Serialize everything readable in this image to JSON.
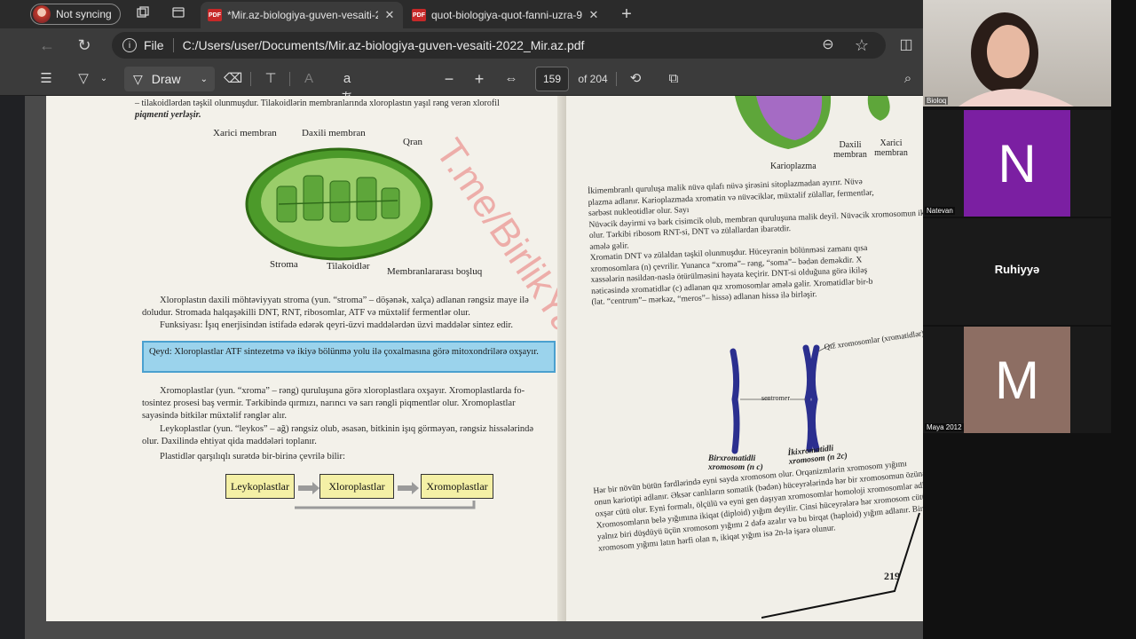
{
  "browser": {
    "profile": "Not syncing",
    "tabs": [
      {
        "title": "*Mir.az-biologiya-guven-vesaiti-2",
        "active": true
      },
      {
        "title": "quot-biologiya-quot-fanni-uzra-9",
        "active": false
      }
    ],
    "new_tab": "+",
    "address": {
      "scheme": "File",
      "path": "C:/Users/user/Documents/Mir.az-biologiya-guven-vesaiti-2022_Mir.az.pdf"
    }
  },
  "pdf_toolbar": {
    "draw_label": "Draw",
    "read_aloud": "aあ",
    "zoom_out": "−",
    "zoom_in": "+",
    "page_current": "159",
    "page_total": "of 204"
  },
  "left_page": {
    "top_line1": "– tilakoidlərdən təşkil olunmuşdur. Tilakoidlərin membranlarında xloroplastın yaşıl rəng verən xlorofil",
    "top_line2": "piqmenti yerləşir.",
    "labels": {
      "outer": "Xarici membran",
      "inner": "Daxili membran",
      "granum": "Qran",
      "stroma": "Stroma",
      "thylakoid": "Tilakoidlər",
      "intermembrane": "Membranlararası boşluq"
    },
    "para1_l1": "Xloroplastın daxili möhtəviyyatı stroma (yun. “stroma” – döşənək, xalça) adlanan rəngsiz maye ilə",
    "para1_l2": "doludur. Stromada halqaşəkilli DNT, RNT, ribosomlar, ATF və müxtəlif fermentlər olur.",
    "para1_l3": "Funksiyası: İşıq enerjisindən istifadə edərək qeyri-üzvi maddələrdən üzvi maddələr sintez edir.",
    "note": "Qeyd: Xloroplastlar ATF sintezetmə və ikiyə bölünmə yolu ilə çoxalmasına görə mitoxondrilərə oxşayır.",
    "para2_l1": "Xromoplastlar (yun. “xroma” – rəng) quruluşuna görə xloroplastlara oxşayır. Xromoplastlarda fo-",
    "para2_l2": "tosintez prosesi baş vermir. Tərkibində qırmızı, narıncı və sarı rəngli piqmentlər olur. Xromoplastlar",
    "para2_l3": "sayəsində bitkilər müxtəlif rənglər alır.",
    "para3_l1": "Leykoplastlar (yun. “leykos” – ağ) rəngsiz olub, əsasən, bitkinin işıq görməyən, rəngsiz hissələrində",
    "para3_l2": "olur. Daxilində ehtiyat qida maddələri toplanır.",
    "para4": "Plastidlər qarşılıqlı surətdə bir-birinə çevrilə bilir:",
    "flow": [
      "Leykoplastlar",
      "Xloroplastlar",
      "Xromoplastlar"
    ]
  },
  "right_page": {
    "labels": {
      "karyoplasm": "Karioplazma",
      "inner": "Daxili membran",
      "outer": "Xarici membran"
    },
    "lines": [
      "İkimembranlı quruluşa malik nüvə qılafı nüvə şirəsini sitoplazmadan ayırır. Nüvə",
      "plazma adlanır. Karioplazmada xromatin və nüvəciklər, müxtəlif zülallar, fermentlər,",
      "sərbəst nukleotidlər olur. Sayı",
      "Nüvəcik dəyirmi və bərk cisimcik olub, membran quruluşuna malik deyil. Nüvəcik xromosomun iki",
      "olur. Tərkibi ribosom RNT-si, DNT və zülallardan ibarətdir.",
      "əmələ gəlir.",
      "Xromatin DNT və zülaldan təşkil olunmuşdur. Hüceyrənin bölünməsi zamanı qısa",
      "xromosomlara (n) çevrilir. Yunanca “xroma”– rəng, “soma”– bədən deməkdir. X",
      "xassələrin nəsildən-nəslə ötürülməsini həyata keçirir. DNT-si olduğuna görə ikiləş",
      "nəticəsində xromatidlər (c) adlanan qız xromosomlar əmələ gəlir. Xromatidlər bir-b",
      "(lat. “centrum”– mərkəz, “meros”– hissə) adlanan hissə ilə birləşir."
    ],
    "chromo_labels": {
      "sister": "Qız xromosomlar (xromatidlər)",
      "centromere": "sentromer",
      "single": "Birxromatidli xromosom (n c)",
      "double": "İkixromatidli xromosom (n 2c)"
    },
    "bottom_lines": [
      "Hər bir növün bütün fərdlərində eyni sayda xromosom olur. Orqanizmlərin xromosom yığımı",
      "onun kariotipi adlanır. Əksər canlıların somatik (bədən) hüceyrələrində hər bir xromosomun özünə",
      "oxşar cütü olur. Eyni formalı, ölçülü və eyni gen daşıyan xromosomlar homoloji xromosomlar adlanır.",
      "Xromosomların belə yığımına ikiqat (diploid) yığım deyilir. Cinsi hüceyrələrə hər xromosom cütündən",
      "yalnız biri düşdüyü üçün xromosom yığımı 2 dəfə azalır və bu birqat (haploid) yığım adlanır. Birqat",
      "xromosom yığımı latın hərfi olan n, ikiqat yığım isə 2n-lə işarə olunur."
    ],
    "page_number": "219"
  },
  "watermark": "T.me/BirlikYarım1",
  "participants": [
    {
      "name": "Bioloq",
      "type": "video"
    },
    {
      "name": "Natevan",
      "letter": "N",
      "color": "#7b1fa2"
    },
    {
      "name": "Ruhiyyə",
      "type": "name-only"
    },
    {
      "name": "Maya 2012",
      "letter": "M",
      "color": "#8d6e63"
    }
  ]
}
